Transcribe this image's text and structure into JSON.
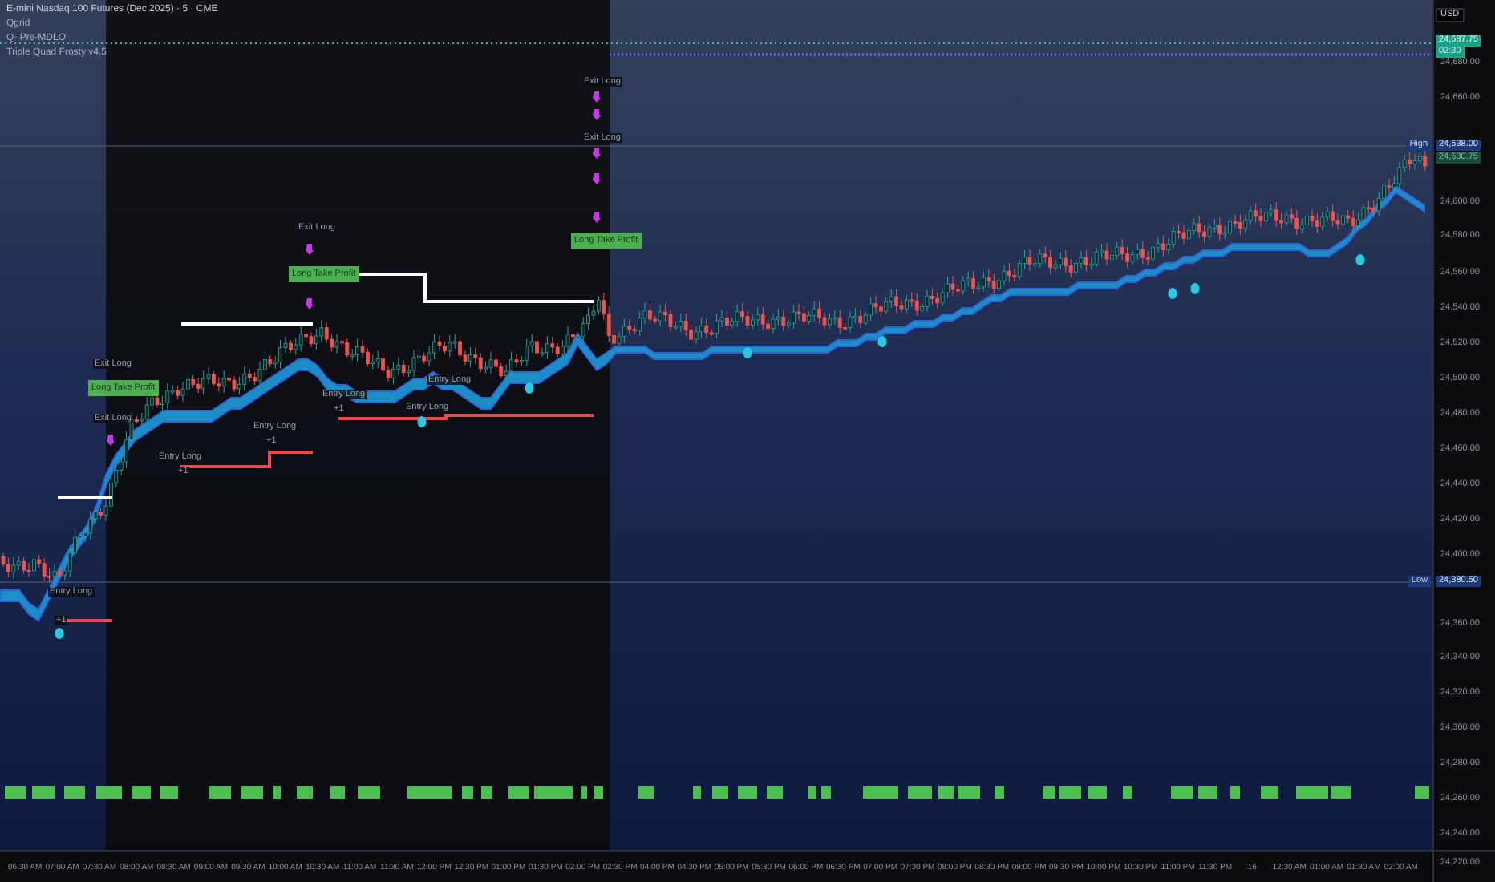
{
  "chart_title": "E-mini Nasdaq 100 Futures (Dec 2025) · 5 · CME",
  "indicators": [
    "Qgrid",
    "Q- Pre-MDLO",
    "Triple Quad Frosty v4.5"
  ],
  "currency": "USD",
  "price_axis": {
    "ticks": [
      "24,680.00",
      "24,660.00",
      "24,600.00",
      "24,580.00",
      "24,560.00",
      "24,540.00",
      "24,520.00",
      "24,500.00",
      "24,480.00",
      "24,460.00",
      "24,440.00",
      "24,420.00",
      "24,400.00",
      "24,360.00",
      "24,340.00",
      "24,320.00",
      "24,300.00",
      "24,280.00",
      "24,260.00",
      "24,240.00",
      "24,220.00"
    ],
    "last_price": "24,687.75",
    "countdown": "02:30",
    "high_label": "High",
    "high_price": "24,638.00",
    "marker_price": "24,630.75",
    "low_label": "Low",
    "low_price": "24,380.50"
  },
  "time_axis": [
    "06:30 AM",
    "07:00 AM",
    "07:30 AM",
    "08:00 AM",
    "08:30 AM",
    "09:00 AM",
    "09:30 AM",
    "10:00 AM",
    "10:30 AM",
    "11:00 AM",
    "11:30 AM",
    "12:00 PM",
    "12:30 PM",
    "01:00 PM",
    "01:30 PM",
    "02:00 PM",
    "02:30 PM",
    "04:00 PM",
    "04:30 PM",
    "05:00 PM",
    "05:30 PM",
    "06:00 PM",
    "06:30 PM",
    "07:00 PM",
    "07:30 PM",
    "08:00 PM",
    "08:30 PM",
    "09:00 PM",
    "09:30 PM",
    "10:00 PM",
    "10:30 PM",
    "11:00 PM",
    "11:30 PM",
    "16",
    "12:30 AM",
    "01:00 AM",
    "01:30 AM",
    "02:00 AM"
  ],
  "annotations": [
    {
      "kind": "entry",
      "text": "Entry Long"
    },
    {
      "kind": "qty",
      "text": "+1"
    },
    {
      "kind": "exit",
      "text": "Exit Long"
    },
    {
      "kind": "take_profit",
      "text": "Long Take Profit"
    },
    {
      "kind": "exit",
      "text": "Exit Long"
    },
    {
      "kind": "entry",
      "text": "Entry Long"
    },
    {
      "kind": "qty",
      "text": "+1"
    },
    {
      "kind": "entry",
      "text": "Entry Long"
    },
    {
      "kind": "qty",
      "text": "+1"
    },
    {
      "kind": "exit",
      "text": "Exit Long"
    },
    {
      "kind": "take_profit",
      "text": "Long Take Profit"
    },
    {
      "kind": "entry",
      "text": "Entry Long"
    },
    {
      "kind": "qty",
      "text": "+1"
    },
    {
      "kind": "entry",
      "text": "Entry Long"
    },
    {
      "kind": "entry",
      "text": "Entry Long"
    },
    {
      "kind": "exit",
      "text": "Exit Long"
    },
    {
      "kind": "exit",
      "text": "Exit Long"
    },
    {
      "kind": "take_profit",
      "text": "Long Take Profit"
    }
  ]
}
